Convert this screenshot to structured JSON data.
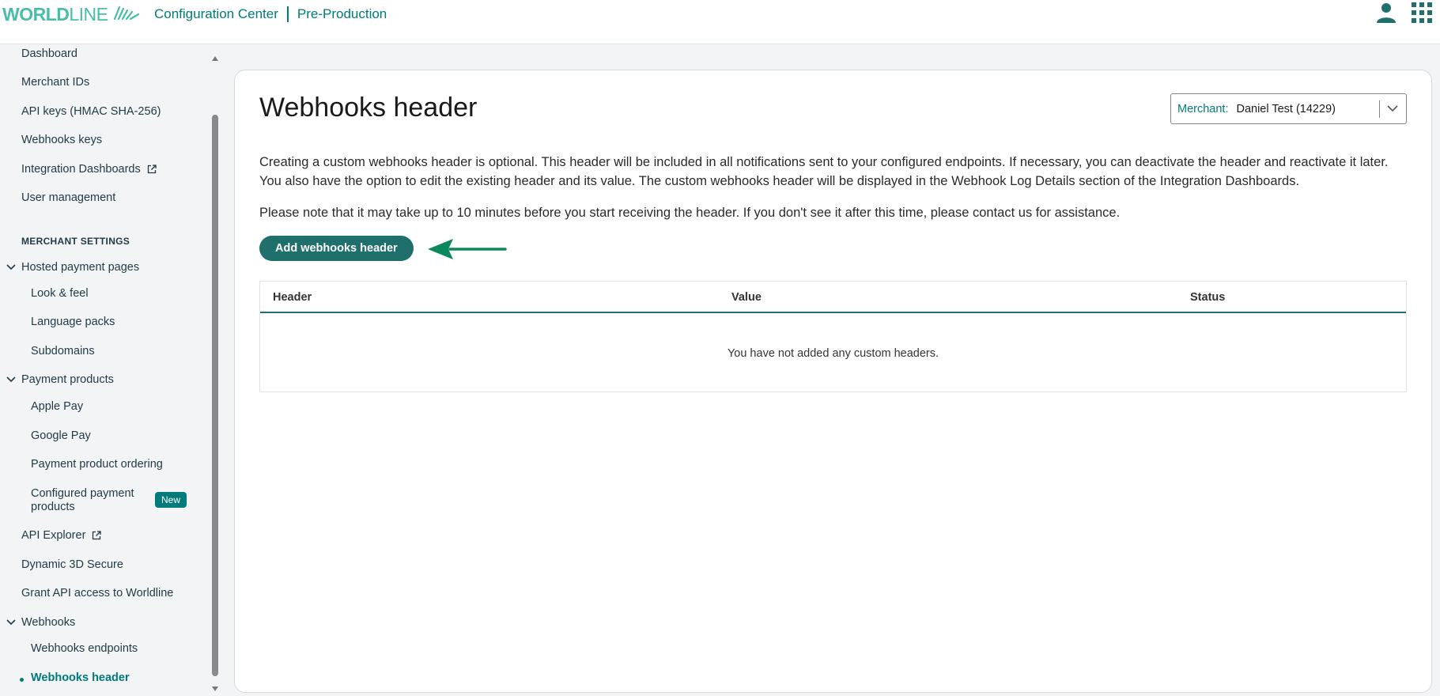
{
  "app": {
    "logo_bold": "WORLD",
    "logo_light": "LINE",
    "title": "Configuration Center",
    "environment": "Pre-Production"
  },
  "sidebar": {
    "items_top": [
      {
        "label": "Dashboard"
      },
      {
        "label": "Merchant IDs"
      },
      {
        "label": "API keys (HMAC SHA-256)"
      },
      {
        "label": "Webhooks keys"
      },
      {
        "label": "Integration Dashboards"
      },
      {
        "label": "User management"
      }
    ],
    "section_label": "MERCHANT SETTINGS",
    "hosted": {
      "label": "Hosted payment pages",
      "children": [
        {
          "label": "Look & feel"
        },
        {
          "label": "Language packs"
        },
        {
          "label": "Subdomains"
        }
      ]
    },
    "payment_products": {
      "label": "Payment products",
      "children": [
        {
          "label": "Apple Pay"
        },
        {
          "label": "Google Pay"
        },
        {
          "label": "Payment product ordering"
        },
        {
          "label_line1": "Configured payment",
          "label_line2": "products",
          "badge": "New"
        }
      ]
    },
    "api_explorer": "API Explorer",
    "dynamic_3ds": "Dynamic 3D Secure",
    "grant_api": "Grant API access to Worldline",
    "webhooks": {
      "label": "Webhooks",
      "children": [
        {
          "label": "Webhooks endpoints"
        },
        {
          "label": "Webhooks header",
          "active": true
        }
      ]
    }
  },
  "main": {
    "title": "Webhooks header",
    "merchant": {
      "label": "Merchant:",
      "value": "Daniel Test (14229)"
    },
    "paragraph1": "Creating a custom webhooks header is optional. This header will be included in all notifications sent to your configured endpoints. If necessary, you can deactivate the header and reactivate it later. You also have the option to edit the existing header and its value. The custom webhooks header will be displayed in the Webhook Log Details section of the Integration Dashboards.",
    "paragraph2": "Please note that it may take up to 10 minutes before you start receiving the header. If you don't see it after this time, please contact us for assistance.",
    "add_button": "Add webhooks header",
    "table": {
      "columns": [
        "Header",
        "Value",
        "Status"
      ],
      "empty_message": "You have not added any custom headers."
    }
  },
  "colors": {
    "brand_teal": "#007a7a",
    "logo_green": "#46beaa",
    "button": "#1f6f6d",
    "arrow": "#0a8a5a"
  }
}
